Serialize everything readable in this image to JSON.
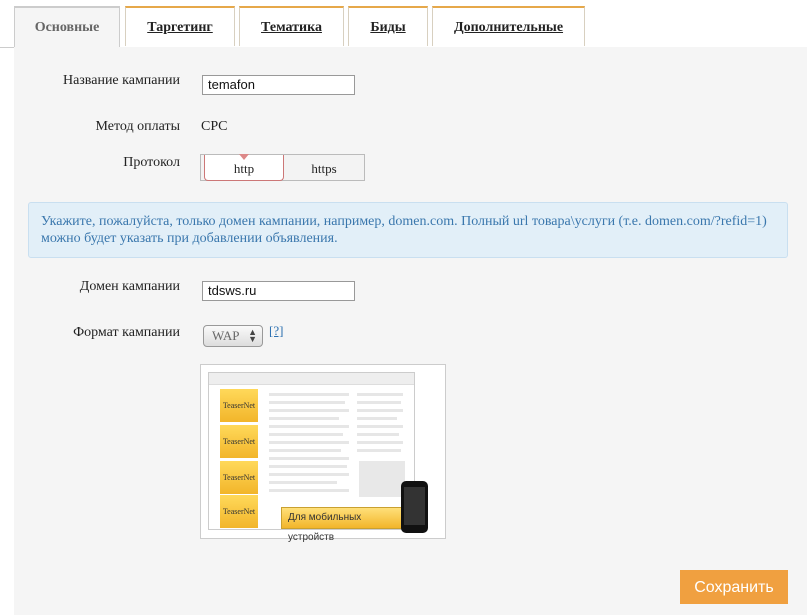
{
  "tabs": [
    {
      "label": "Основные",
      "active": true
    },
    {
      "label": "Таргетинг",
      "active": false
    },
    {
      "label": "Тематика",
      "active": false
    },
    {
      "label": "Биды",
      "active": false
    },
    {
      "label": "Дополнительные",
      "active": false
    }
  ],
  "form": {
    "campaign_name_label": "Название кампании",
    "campaign_name_value": "temafon",
    "payment_method_label": "Метод оплаты",
    "payment_method_value": "CPC",
    "protocol_label": "Протокол",
    "protocol_options": [
      "http",
      "https"
    ],
    "protocol_selected": "http",
    "info_text": "Укажите, пожалуйста, только домен кампании, например, domen.com. Полный url товара\\услуги (т.е. domen.com/?refid=1) можно будет указать при добавлении объявления.",
    "domain_label": "Домен кампании",
    "domain_value": "tdsws.ru",
    "format_label": "Формат кампании",
    "format_selected": "WAP",
    "format_help": "[?]"
  },
  "preview": {
    "ad_labels": [
      "TeaserNet",
      "TeaserNet",
      "TeaserNet",
      "TeaserNet"
    ],
    "mobile_caption": "Для мобильных устройств"
  },
  "actions": {
    "save_label": "Сохранить"
  },
  "colors": {
    "accent": "#f0a040",
    "info_bg": "#e2eff8",
    "info_text": "#3a77ad",
    "link": "#2a6fb0"
  }
}
